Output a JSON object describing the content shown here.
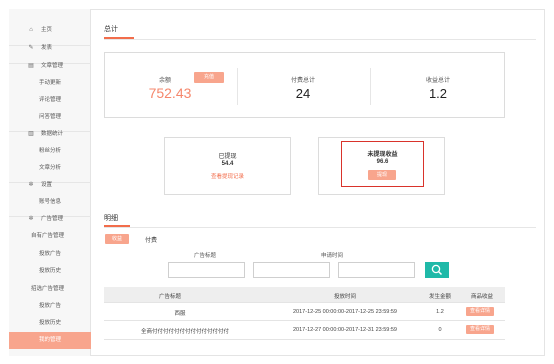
{
  "sidebar": {
    "items": [
      {
        "label": "主页",
        "icon": "home-icon",
        "glyph": "⌂"
      },
      {
        "label": "发表",
        "icon": "edit-icon",
        "glyph": "✎"
      },
      {
        "label": "文章管理",
        "icon": "document-icon",
        "glyph": "▤"
      },
      {
        "label": "手动更新"
      },
      {
        "label": "评论管理"
      },
      {
        "label": "问答管理"
      },
      {
        "label": "数据统计",
        "icon": "chart-icon",
        "glyph": "▥"
      },
      {
        "label": "粉丝分析"
      },
      {
        "label": "文章分析"
      },
      {
        "label": "设置",
        "icon": "gear-icon",
        "glyph": "✲"
      },
      {
        "label": "账号信息"
      },
      {
        "label": "广告管理",
        "icon": "gear-icon",
        "glyph": "✲"
      },
      {
        "label": "自有广告管理"
      },
      {
        "label": "投放广告"
      },
      {
        "label": "投放历史"
      },
      {
        "label": "招选广告管理"
      },
      {
        "label": "投放广告"
      },
      {
        "label": "投放历史"
      },
      {
        "label": "我的管理"
      }
    ]
  },
  "summary": {
    "tab_label": "总计",
    "balance_label": "余额",
    "balance_value": "752.43",
    "withdraw_button": "充值",
    "paid_total_label": "付费总计",
    "paid_total_value": "24",
    "income_total_label": "收益总计",
    "income_total_value": "1.2"
  },
  "withdrawn": {
    "label": "已提现",
    "value": "54.4",
    "link": "查看提现记录"
  },
  "not_withdrawn": {
    "label": "未提现收益",
    "value": "96.6",
    "button": "提现"
  },
  "details": {
    "tab_label": "明细",
    "filter_income": "收益",
    "filter_paid": "付费",
    "ad_title_label": "广告标题",
    "apply_time_label": "申请时间",
    "columns": [
      "广告标题",
      "投放时间",
      "发生金额",
      "商品收益"
    ],
    "rows": [
      {
        "title": "西服",
        "time": "2017-12-25 00:00:00-2017-12-25 23:59:59",
        "amount": "1.2",
        "action": "查看详情"
      },
      {
        "title": "全商付付付付付付付付付付付付付付",
        "time": "2017-12-27 00:00:00-2017-12-31 23:59:59",
        "amount": "0",
        "action": "查看详情"
      }
    ]
  },
  "colors": {
    "accent": "#f26d4b",
    "accent_light": "#f8a58d",
    "teal": "#1fb9a8",
    "highlight_border": "#d9332b"
  }
}
